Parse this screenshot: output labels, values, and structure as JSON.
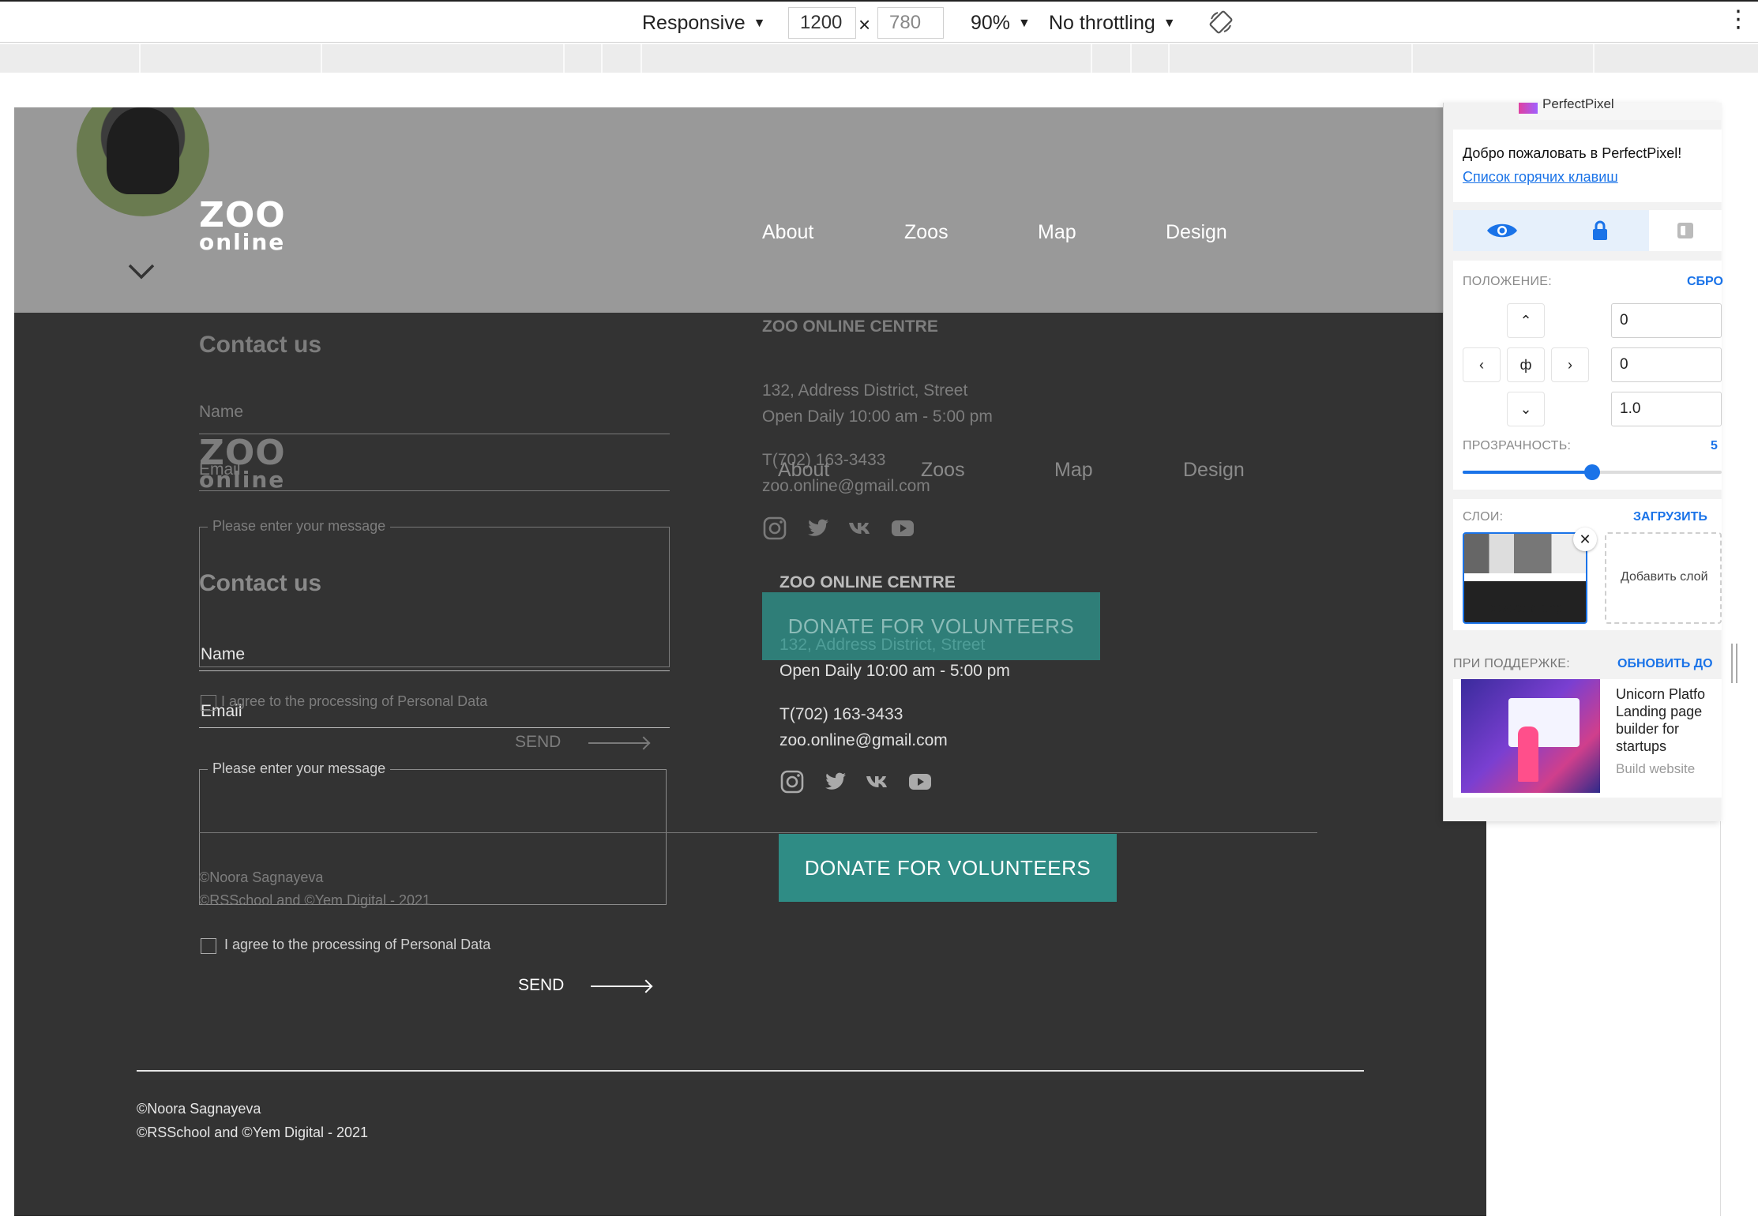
{
  "devtools": {
    "device": "Responsive",
    "width": "1200",
    "times": "×",
    "height": "780",
    "zoom": "90%",
    "throttle": "No throttling"
  },
  "site": {
    "logo_line1": "ZOO",
    "logo_line2": "online",
    "nav": [
      "About",
      "Zoos",
      "Map",
      "Design"
    ],
    "contact_title": "Contact us",
    "name_label": "Name",
    "email_label": "Email",
    "message_placeholder": "Please enter your message",
    "agree_label": "I agree to the processing of Personal Data",
    "send_label": "SEND",
    "centre_title": "ZOO ONLINE CENTRE",
    "address": "132, Address District, Street",
    "hours": "Open Daily 10:00 am - 5:00 pm",
    "phone": "T(702) 163-3433",
    "email": "zoo.online@gmail.com",
    "donate_label": "DONATE FOR VOLUNTEERS",
    "copyright1": "©Noora Sagnayeva",
    "copyright2": "©RSSchool and ©Yem Digital - 2021",
    "social_icons": [
      "instagram-icon",
      "twitter-icon",
      "vk-icon",
      "youtube-icon"
    ],
    "accent_color": "#2f8c85"
  },
  "perfectpixel": {
    "header_title": "PerfectPixel",
    "welcome": "Добро пожаловать в PerfectPixel!",
    "hotkeys_link": "Список горячих клавиш",
    "position_label": "ПОЛОЖЕНИЕ:",
    "reset_label": "СБРО",
    "center_symbol": "ф",
    "x_value": "0",
    "y_value": "0",
    "scale_value": "1.0",
    "opacity_label": "ПРОЗРАЧНОСТЬ:",
    "opacity_value_text": "5",
    "opacity": 0.5,
    "layers_label": "СЛОИ:",
    "upload_label": "ЗАГРУЗИТЬ",
    "layer_name": "desktop.png",
    "add_layer": "Добавить слой",
    "support_label": "ПРИ ПОДДЕРЖКЕ:",
    "upgrade_label": "ОБНОВИТЬ ДО",
    "ad_title": "Unicorn Platfo Landing page builder for startups",
    "ad_link": "Build website"
  }
}
